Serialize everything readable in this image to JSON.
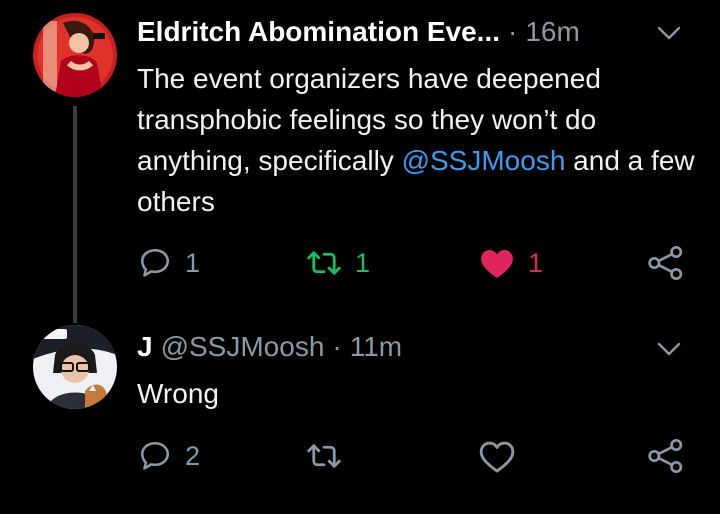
{
  "tweets": [
    {
      "display_name": "Eldritch Abomination Eve...",
      "separator": "·",
      "time": "16m",
      "text_parts": [
        "The event organizers have deepened transphobic feelings so they won’t do anything, specifically ",
        "@SSJMoosh",
        " and a few others"
      ],
      "reply_count": "1",
      "retweet_count": "1",
      "like_count": "1",
      "retweeted": true,
      "liked": true
    },
    {
      "display_name": "J",
      "handle": "@SSJMoosh",
      "separator": "·",
      "time": "11m",
      "text": "Wrong",
      "reply_count": "2",
      "retweet_count": "",
      "like_count": "",
      "retweeted": false,
      "liked": false
    }
  ],
  "colors": {
    "background": "#000000",
    "mention": "#3d9bf0",
    "retweet_active": "#17bf63",
    "like_active": "#e0245e",
    "icon_default": "#8b98a5",
    "thread_line": "#3b3f44"
  },
  "icons": {
    "reply": "speech-bubble-icon",
    "retweet": "retweet-arrows-icon",
    "like": "heart-icon",
    "share": "share-nodes-icon",
    "caret": "chevron-down-icon"
  }
}
